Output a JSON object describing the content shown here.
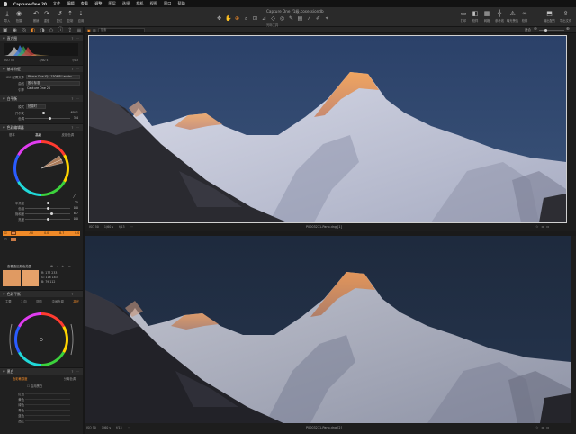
{
  "menubar": {
    "app_name": "Capture One 20",
    "items": [
      "文件",
      "编辑",
      "查看",
      "调整",
      "图层",
      "选择",
      "相机",
      "视图",
      "窗口",
      "帮助"
    ]
  },
  "window": {
    "title": "Capture One \"1级.cosessiondb"
  },
  "toolbar": {
    "left_buttons": [
      {
        "icon": "import-icon",
        "label": "导入"
      },
      {
        "icon": "capture-icon",
        "label": "拍摄"
      },
      {
        "icon": "undo-icon",
        "label": "撤销"
      },
      {
        "icon": "redo-icon",
        "label": "重做"
      },
      {
        "icon": "reset-icon",
        "label": "复位"
      },
      {
        "icon": "copy-adjustments-icon",
        "label": "复制"
      },
      {
        "icon": "apply-adjustments-icon",
        "label": "应用"
      }
    ],
    "cursor_tools_label": "光标工具",
    "right_buttons": [
      {
        "icon": "print-icon",
        "label": "打印"
      },
      {
        "icon": "proof-icon",
        "label": "校样"
      },
      {
        "icon": "grid-icon",
        "label": "网格"
      },
      {
        "icon": "guides-icon",
        "label": "参考线"
      },
      {
        "icon": "exposure-warning-icon",
        "label": "曝光警告"
      },
      {
        "icon": "proofing-glasses-icon",
        "label": "校样"
      },
      {
        "icon": "process-recipe-icon",
        "label": "输出配方"
      },
      {
        "icon": "export-icon",
        "label": "导出文件"
      }
    ]
  },
  "viewer_toolbar": {
    "search_text": "搜索",
    "fit_label": "适合",
    "zoom_label": "适合"
  },
  "histogram": {
    "title": "直方图",
    "iso": "ISO 50",
    "shutter": "1/60 s",
    "aperture": "f/13"
  },
  "base_characteristics": {
    "title": "基本特征",
    "rows": [
      {
        "label": "ICC 配置文件",
        "value": "Phase One IQ4 150MP Landsc..."
      },
      {
        "label": "曲线",
        "value": "胶片标准"
      },
      {
        "label": "引擎",
        "value": "Capture One 20"
      }
    ]
  },
  "white_balance": {
    "title": "白平衡",
    "mode_label": "模式",
    "mode_value": "拍摄时",
    "rows": [
      {
        "label": "开尔文",
        "value": "6041"
      },
      {
        "label": "色调",
        "value": "3.4"
      }
    ]
  },
  "color_editor": {
    "title": "色彩编辑器",
    "tabs": [
      "基本",
      "高级",
      "皮肤色调"
    ],
    "sliders": [
      {
        "label": "平滑度",
        "value": "25"
      },
      {
        "label": "色相",
        "value": "0.0"
      },
      {
        "label": "饱和度",
        "value": "8.7"
      },
      {
        "label": "亮度",
        "value": "0.0"
      }
    ],
    "range_values": [
      "-90",
      "0.0",
      "8.7",
      "0.0"
    ]
  },
  "color_readout": {
    "title": "查看选区颜色范围",
    "rgb_values": [
      "R: 177 233",
      "G: 116 183",
      "B: 79 112"
    ]
  },
  "color_balance": {
    "title": "色彩平衡",
    "tabs": [
      "主要",
      "3 向",
      "阴影",
      "中间色调",
      "高光"
    ]
  },
  "black_white": {
    "title": "黑白",
    "tabs": [
      "色彩敏感度",
      "分离色调"
    ],
    "checkbox_label": "启用黑白",
    "rows": [
      "红色",
      "黄色",
      "绿色",
      "青色",
      "蓝色",
      "品红"
    ]
  },
  "viewer": {
    "top_image": {
      "filename": "P0003271-Pano.dng [1]",
      "iso": "ISO 50",
      "shutter": "1/60 s",
      "aperture": "f/13"
    },
    "bottom_image": {
      "filename": "P0003271-Pano.dng [2]",
      "iso": "ISO 50",
      "shutter": "1/60 s",
      "aperture": "f/13"
    }
  },
  "colors": {
    "accent": "#f08a28",
    "panel_bg": "#202020",
    "toolbar_bg": "#2a2a2a",
    "top_sky": "#2e4468",
    "bottom_sky": "#1f2b3d"
  }
}
